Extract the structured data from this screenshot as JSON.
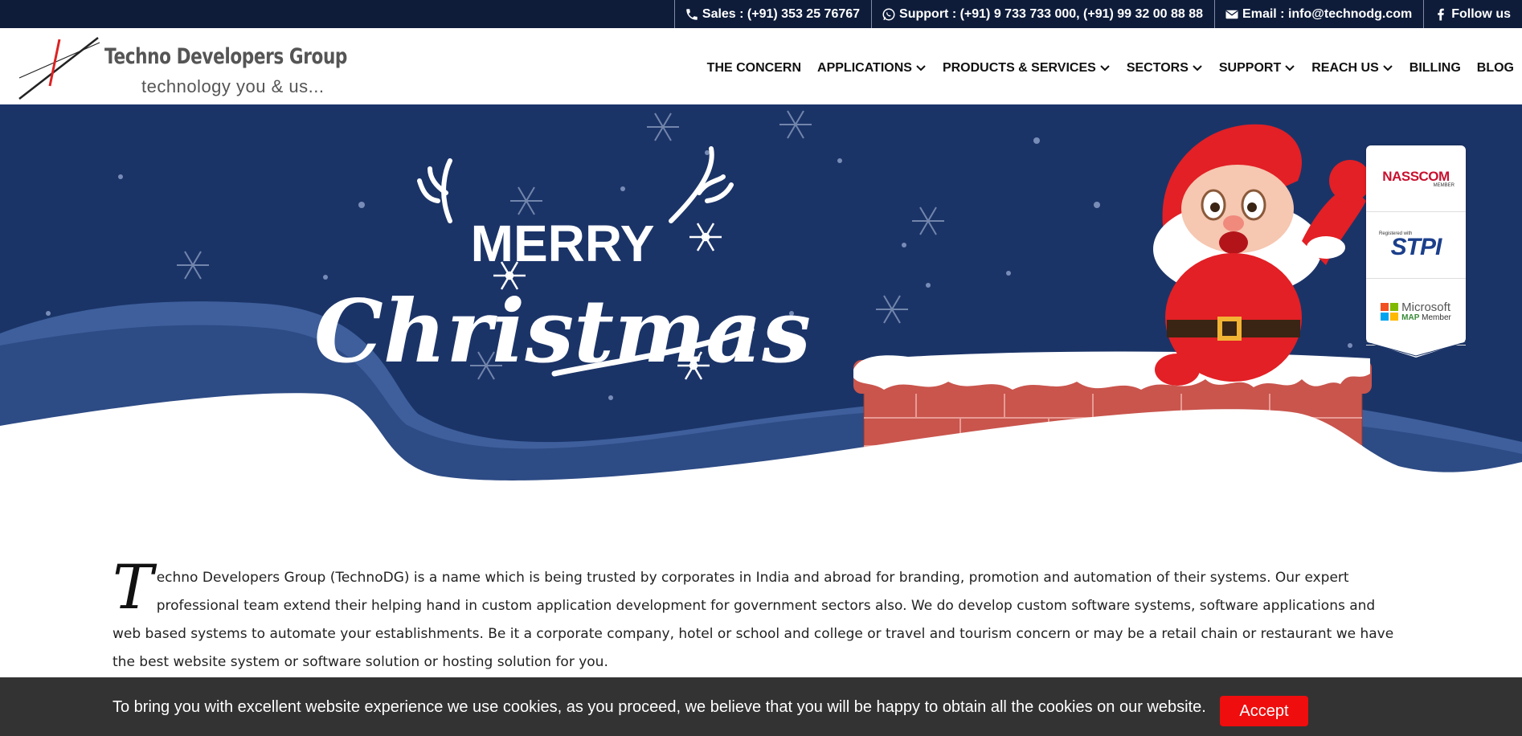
{
  "topbar": {
    "sales": "Sales : (+91) 353 25 76767",
    "support": "Support : (+91) 9 733 733 000, (+91) 99 32 00 88 88",
    "email": "Email : info@technodg.com",
    "follow": "Follow us",
    "icons": [
      "phone-icon",
      "whatsapp-icon",
      "envelope-icon",
      "facebook-icon"
    ]
  },
  "logo": {
    "title": "Techno Developers Group",
    "tagline": "technology you & us..."
  },
  "nav": {
    "items": [
      {
        "label": "THE CONCERN",
        "dropdown": false
      },
      {
        "label": "APPLICATIONS",
        "dropdown": true
      },
      {
        "label": "PRODUCTS & SERVICES",
        "dropdown": true
      },
      {
        "label": "SECTORS",
        "dropdown": true
      },
      {
        "label": "SUPPORT",
        "dropdown": true
      },
      {
        "label": "REACH US",
        "dropdown": true
      },
      {
        "label": "BILLING",
        "dropdown": false
      },
      {
        "label": "BLOG",
        "dropdown": false
      }
    ]
  },
  "hero": {
    "line1": "MERRY",
    "line2": "Christmas"
  },
  "badges": {
    "nasscom": "NASSCOM",
    "nasscom_sub": "MEMBER",
    "stpi_top": "Registered with",
    "stpi": "STPI",
    "microsoft": "Microsoft",
    "microsoft_map": "MAP",
    "microsoft_member": "Member"
  },
  "intro": {
    "dropcap": "T",
    "text": "echno Developers Group (TechnoDG) is a name which is being trusted by corporates in India and abroad for branding, promotion and automation of their systems. Our expert professional team extend their helping hand in custom application development for government sectors also. We do develop custom software systems, software applications and web based systems to automate your establishments. Be it a corporate company, hotel or school and college or travel and tourism concern or may be a retail chain or restaurant we have the best website system or software solution or hosting solution for you."
  },
  "cookie": {
    "message": "To bring you with excellent website experience we use cookies, as you proceed, we believe that you will be happy to obtain all the cookies on our website.",
    "accept": "Accept"
  },
  "colors": {
    "topbar_bg": "#0e1c3a",
    "hero_bg": "#1b3468",
    "cookie_bg": "#333333",
    "accept_bg": "#ef0d0d"
  }
}
